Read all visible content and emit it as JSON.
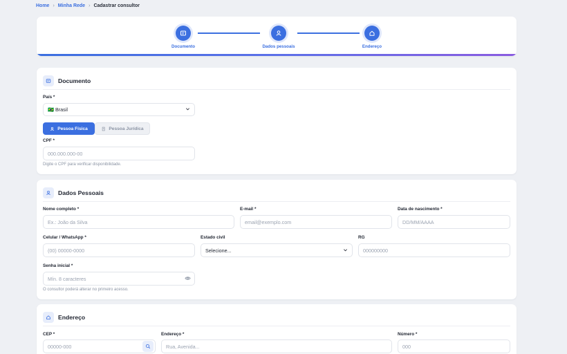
{
  "breadcrumb": {
    "home": "Home",
    "network": "Minha Rede",
    "current": "Cadastrar consultor"
  },
  "stepper": {
    "steps": [
      {
        "label": "Documento",
        "icon": "document-icon"
      },
      {
        "label": "Dados pessoais",
        "icon": "user-icon"
      },
      {
        "label": "Endereço",
        "icon": "home-icon"
      }
    ]
  },
  "documento": {
    "title": "Documento",
    "country_label": "País *",
    "country_value": "🇧🇷 Brasil",
    "tab_fisica": "Pessoa Física",
    "tab_juridica": "Pessoa Jurídica",
    "cpf_label": "CPF *",
    "cpf_placeholder": "000.000.000-00",
    "cpf_hint": "Digite o CPF para verificar disponibilidade."
  },
  "dados": {
    "title": "Dados Pessoais",
    "name_label": "Nome completo *",
    "name_placeholder": "Ex.: João da Silva",
    "email_label": "E-mail *",
    "email_placeholder": "email@exemplo.com",
    "birth_label": "Data de nascimento *",
    "birth_placeholder": "DD/MM/AAAA",
    "phone_label": "Celular / WhatsApp *",
    "phone_placeholder": "(00) 00000-0000",
    "civil_label": "Estado civil",
    "civil_value": "Selecione...",
    "rg_label": "RG",
    "rg_placeholder": "000000000",
    "password_label": "Senha inicial *",
    "password_placeholder": "Mín. 8 caracteres",
    "password_hint": "O consultor poderá alterar no primeiro acesso."
  },
  "endereco": {
    "title": "Endereço",
    "cep_label": "CEP *",
    "cep_placeholder": "00000-000",
    "address_label": "Endereço *",
    "address_placeholder": "Rua, Avenida...",
    "number_label": "Número *",
    "number_placeholder": "000"
  },
  "colors": {
    "accent": "#3b6fe0",
    "accent_soft": "#e7edfb",
    "page_bg": "#eef0f4",
    "gradient_end": "#8a5be0"
  }
}
